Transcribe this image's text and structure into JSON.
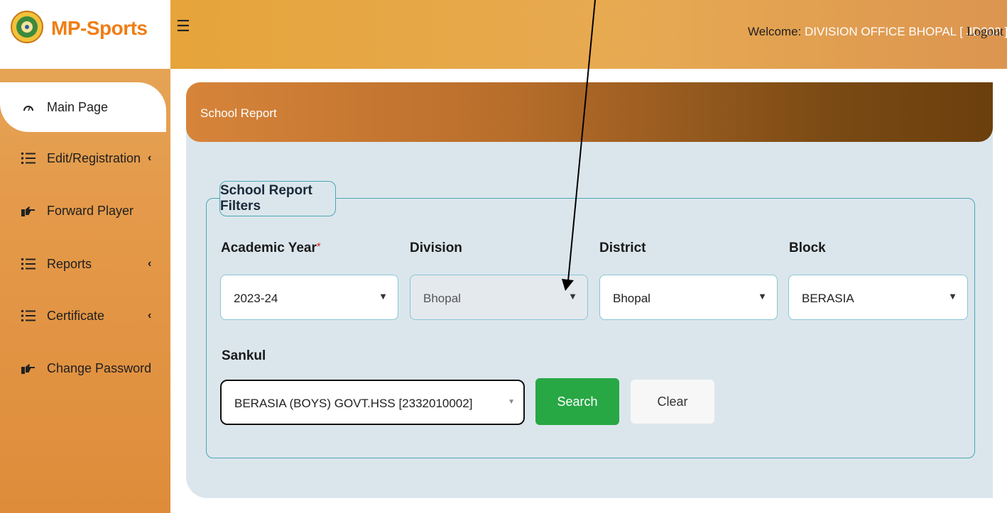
{
  "app": {
    "brand": "MP-Sports"
  },
  "header": {
    "welcome_prefix": "Welcome: ",
    "user": "DIVISION OFFICE BHOPAL [ JD002 ]",
    "logout": "Logout"
  },
  "sidebar": {
    "items": [
      {
        "label": "Main Page",
        "icon": "dashboard-icon",
        "active": true
      },
      {
        "label": "Edit/Registration",
        "icon": "list-icon",
        "chevron": "‹"
      },
      {
        "label": "Forward Player",
        "icon": "hand-point-icon"
      },
      {
        "label": "Reports",
        "icon": "list-icon",
        "chevron": "‹"
      },
      {
        "label": "Certificate",
        "icon": "list-icon",
        "chevron": "‹"
      },
      {
        "label": "Change Password",
        "icon": "hand-point-icon"
      }
    ]
  },
  "card": {
    "title": "School Report"
  },
  "filters": {
    "legend": "School Report Filters",
    "academic_year": {
      "label": "Academic Year",
      "required": "*",
      "value": "2023-24"
    },
    "division": {
      "label": "Division",
      "value": "Bhopal"
    },
    "district": {
      "label": "District",
      "value": "Bhopal"
    },
    "block": {
      "label": "Block",
      "value": "BERASIA"
    },
    "sankul": {
      "label": "Sankul",
      "value": "BERASIA (BOYS) GOVT.HSS [2332010002]"
    }
  },
  "buttons": {
    "search": "Search",
    "clear": "Clear"
  },
  "colors": {
    "accent_orange": "#f07d14",
    "search_green": "#28a745",
    "fieldset_border": "#4aa7b7"
  }
}
